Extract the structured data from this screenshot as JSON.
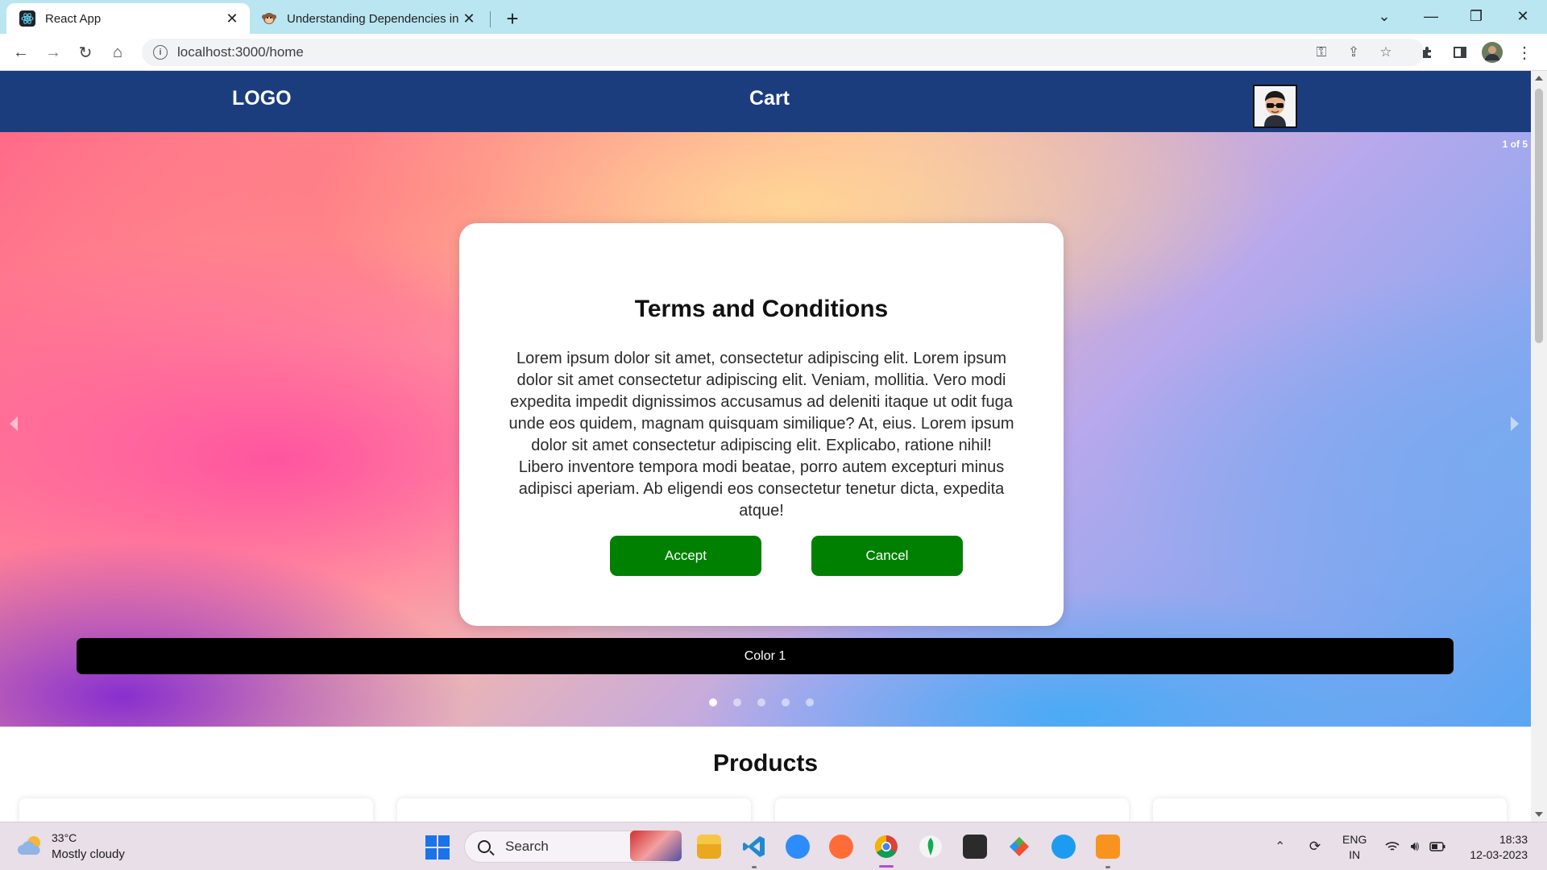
{
  "browser": {
    "tabs": [
      {
        "title": "React App",
        "favicon": "react-icon",
        "active": true
      },
      {
        "title": "Understanding Dependencies in",
        "favicon": "monkey-icon",
        "active": false
      }
    ],
    "url": "localhost:3000/home"
  },
  "navbar": {
    "logo": "LOGO",
    "cart": "Cart",
    "avatar": "memoji-avatar"
  },
  "carousel": {
    "counter": "1 of 5",
    "caption": "Color 1",
    "slide_count": 5,
    "active_slide": 1
  },
  "modal": {
    "title": "Terms and Conditions",
    "body": "Lorem ipsum dolor sit amet, consectetur adipiscing elit. Lorem ipsum dolor sit amet consectetur adipiscing elit. Veniam, mollitia. Vero modi expedita impedit dignissimos accusamus ad deleniti itaque ut odit fuga unde eos quidem, magnam quisquam similique? At, eius. Lorem ipsum dolor sit amet consectetur adipiscing elit. Explicabo, ratione nihil! Libero inventore tempora modi beatae, porro autem excepturi minus adipisci aperiam. Ab eligendi eos consectetur tenetur dicta, expedita atque!",
    "accept_label": "Accept",
    "cancel_label": "Cancel",
    "button_color": "#008000"
  },
  "products": {
    "title": "Products"
  },
  "taskbar": {
    "weather_temp": "33°C",
    "weather_desc": "Mostly cloudy",
    "search_placeholder": "Search",
    "lang_line1": "ENG",
    "lang_line2": "IN",
    "time": "18:33",
    "date": "12-03-2023"
  },
  "colors": {
    "navbar": "#1b3d7d",
    "tabstrip": "#b9e6f1",
    "caption_bar": "#000000"
  }
}
